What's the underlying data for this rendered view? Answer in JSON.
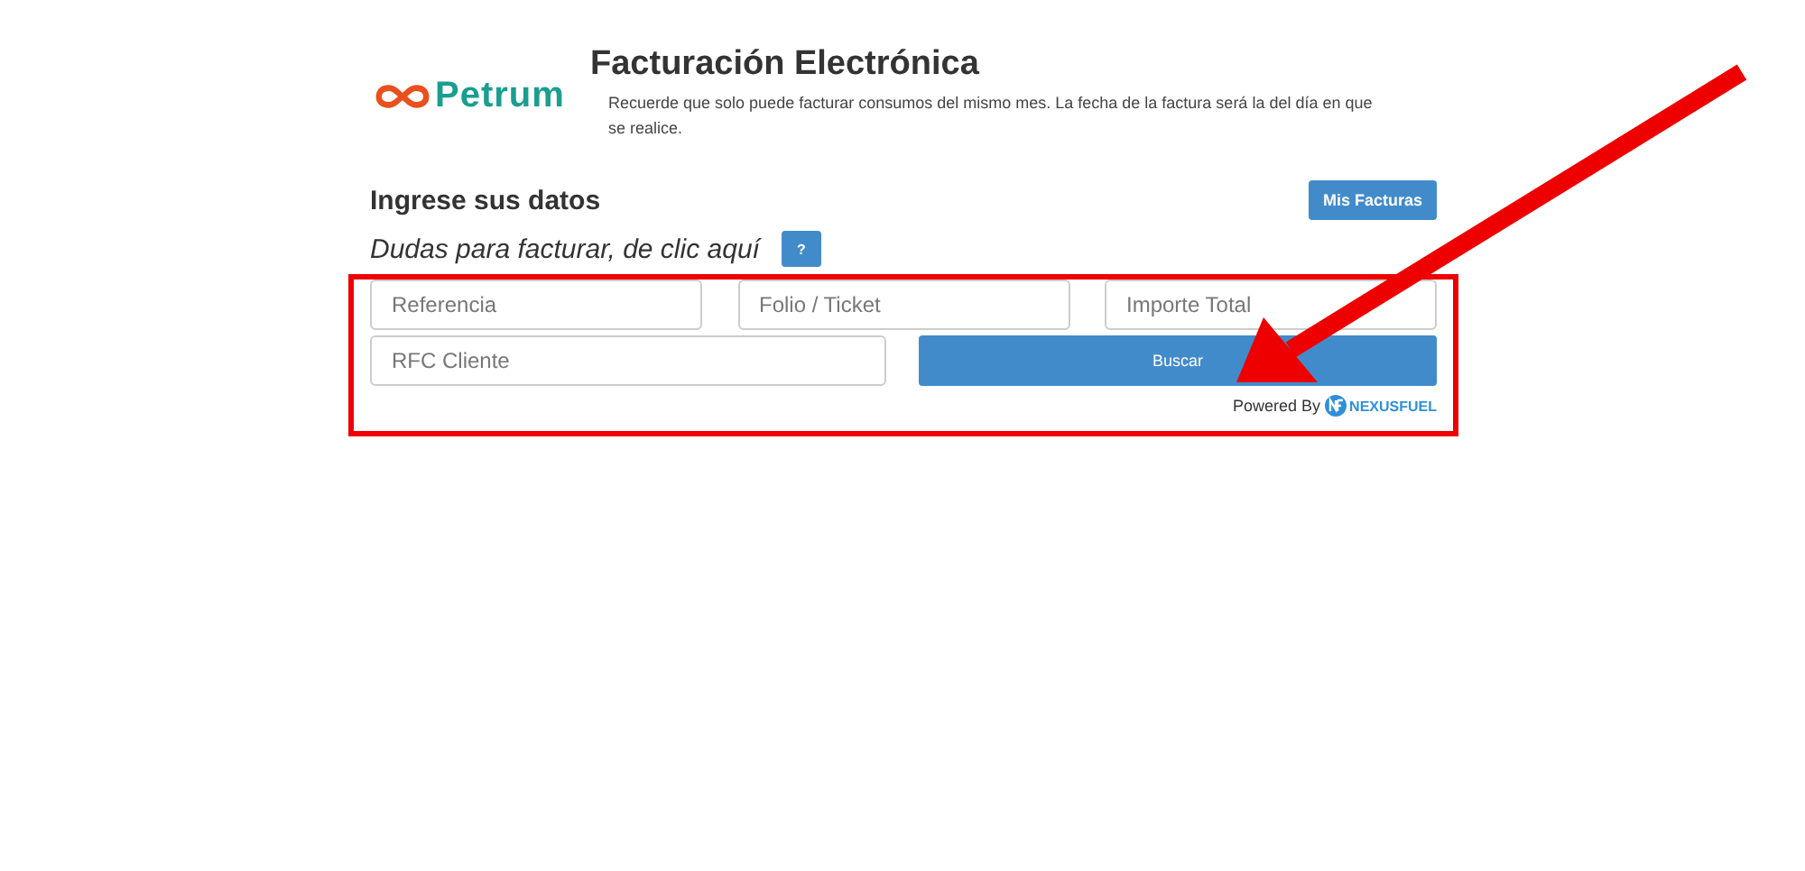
{
  "brand": {
    "name": "Petrum"
  },
  "header": {
    "title": "Facturación Electrónica",
    "notice": "Recuerde que solo puede facturar consumos del mismo mes. La fecha de la factura será la del día en que se realice."
  },
  "form": {
    "heading": "Ingrese sus datos",
    "my_invoices_button": "Mis Facturas",
    "help_text": "Dudas para facturar, de clic aquí",
    "help_button": "?",
    "fields": [
      {
        "placeholder": "Referencia"
      },
      {
        "placeholder": "Folio / Ticket"
      },
      {
        "placeholder": "Importe Total"
      },
      {
        "placeholder": "RFC Cliente"
      }
    ],
    "search_button": "Buscar",
    "powered_by": "Powered By",
    "provider": "NEXUSFUEL"
  }
}
